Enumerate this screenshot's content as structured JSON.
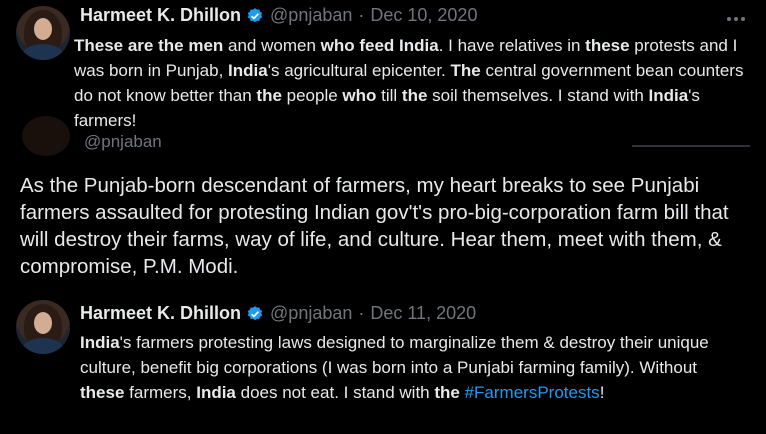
{
  "tweets": [
    {
      "author": "Harmeet K. Dhillon",
      "handle": "@pnjaban",
      "separator": "·",
      "date": "Dec 10, 2020",
      "more_icon": "more-icon",
      "segments": [
        {
          "t": "These are the men",
          "bold": true
        },
        {
          "t": " and women "
        },
        {
          "t": "who feed India",
          "bold": true
        },
        {
          "t": ". I have relatives in "
        },
        {
          "t": "these",
          "bold": true
        },
        {
          "t": " protests and I was born in Punjab, "
        },
        {
          "t": "India",
          "bold": true
        },
        {
          "t": "'s agricultural epicenter. "
        },
        {
          "t": "The",
          "bold": true
        },
        {
          "t": " central government bean counters do not know better than "
        },
        {
          "t": "the",
          "bold": true
        },
        {
          "t": " people "
        },
        {
          "t": "who",
          "bold": true
        },
        {
          "t": " till "
        },
        {
          "t": "the",
          "bold": true
        },
        {
          "t": " soil themselves. I stand with "
        },
        {
          "t": "India",
          "bold": true
        },
        {
          "t": "'s farmers!"
        }
      ]
    },
    {
      "handle": "@pnjaban",
      "text": "As the Punjab-born descendant of farmers, my heart breaks to see Punjabi farmers assaulted for protesting Indian gov't's pro-big-corporation farm bill that will destroy their farms, way of life, and culture. Hear them, meet with them, & compromise, P.M. Modi."
    },
    {
      "author": "Harmeet K. Dhillon",
      "handle": "@pnjaban",
      "separator": "·",
      "date": "Dec 11, 2020",
      "segments": [
        {
          "t": "India",
          "bold": true
        },
        {
          "t": "'s farmers protesting laws designed to marginalize them & destroy their unique culture, benefit big corporations (I was born into a Punjabi farming family). Without "
        },
        {
          "t": "these",
          "bold": true
        },
        {
          "t": " farmers, "
        },
        {
          "t": "India",
          "bold": true
        },
        {
          "t": " does not eat. I stand with "
        },
        {
          "t": "the",
          "bold": true
        },
        {
          "t": " "
        },
        {
          "t": "#FarmersProtests",
          "hashtag": true
        },
        {
          "t": "!"
        }
      ]
    }
  ],
  "colors": {
    "background": "#000000",
    "text": "#e7e9ea",
    "muted": "#71767b",
    "verified": "#1d9bf0",
    "hashtag": "#1d9bf0"
  }
}
